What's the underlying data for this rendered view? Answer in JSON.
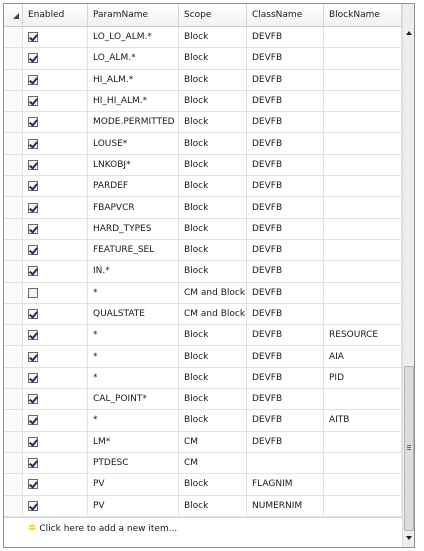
{
  "columns": {
    "enabled": "Enabled",
    "param_name": "ParamName",
    "scope": "Scope",
    "class_name": "ClassName",
    "block_name": "BlockName"
  },
  "rows": [
    {
      "enabled": true,
      "param": "LO_LO_ALM.*",
      "scope": "Block",
      "class": "DEVFB",
      "block": ""
    },
    {
      "enabled": true,
      "param": "LO_ALM.*",
      "scope": "Block",
      "class": "DEVFB",
      "block": ""
    },
    {
      "enabled": true,
      "param": "HI_ALM.*",
      "scope": "Block",
      "class": "DEVFB",
      "block": ""
    },
    {
      "enabled": true,
      "param": "HI_HI_ALM.*",
      "scope": "Block",
      "class": "DEVFB",
      "block": ""
    },
    {
      "enabled": true,
      "param": "MODE.PERMITTED",
      "scope": "Block",
      "class": "DEVFB",
      "block": ""
    },
    {
      "enabled": true,
      "param": "LOUSE*",
      "scope": "Block",
      "class": "DEVFB",
      "block": ""
    },
    {
      "enabled": true,
      "param": "LNKOBJ*",
      "scope": "Block",
      "class": "DEVFB",
      "block": ""
    },
    {
      "enabled": true,
      "param": "PARDEF",
      "scope": "Block",
      "class": "DEVFB",
      "block": ""
    },
    {
      "enabled": true,
      "param": "FBAPVCR",
      "scope": "Block",
      "class": "DEVFB",
      "block": ""
    },
    {
      "enabled": true,
      "param": "HARD_TYPES",
      "scope": "Block",
      "class": "DEVFB",
      "block": ""
    },
    {
      "enabled": true,
      "param": "FEATURE_SEL",
      "scope": "Block",
      "class": "DEVFB",
      "block": ""
    },
    {
      "enabled": true,
      "param": "IN.*",
      "scope": "Block",
      "class": "DEVFB",
      "block": ""
    },
    {
      "enabled": false,
      "param": "*",
      "scope": "CM and Block",
      "class": "DEVFB",
      "block": ""
    },
    {
      "enabled": true,
      "param": "QUALSTATE",
      "scope": "CM and Block",
      "class": "DEVFB",
      "block": ""
    },
    {
      "enabled": true,
      "param": "*",
      "scope": "Block",
      "class": "DEVFB",
      "block": "RESOURCE"
    },
    {
      "enabled": true,
      "param": "*",
      "scope": "Block",
      "class": "DEVFB",
      "block": "AIA"
    },
    {
      "enabled": true,
      "param": "*",
      "scope": "Block",
      "class": "DEVFB",
      "block": "PID"
    },
    {
      "enabled": true,
      "param": "CAL_POINT*",
      "scope": "Block",
      "class": "DEVFB",
      "block": ""
    },
    {
      "enabled": true,
      "param": "*",
      "scope": "Block",
      "class": "DEVFB",
      "block": "AITB"
    },
    {
      "enabled": true,
      "param": "LM*",
      "scope": "CM",
      "class": "DEVFB",
      "block": ""
    },
    {
      "enabled": true,
      "param": "PTDESC",
      "scope": "CM",
      "class": "",
      "block": ""
    },
    {
      "enabled": true,
      "param": "PV",
      "scope": "Block",
      "class": "FLAGNIM",
      "block": ""
    },
    {
      "enabled": true,
      "param": "PV",
      "scope": "Block",
      "class": "NUMERNIM",
      "block": ""
    }
  ],
  "add_row": {
    "label": "Click here to add a new item...",
    "icon": "new-item-star-icon"
  },
  "scrollbar": {
    "position_fraction": 1.0
  },
  "colors": {
    "grid_border": "#8f8f8f",
    "header_bg": "#f1f2f4",
    "checkmark": "#1c2f6a",
    "add_icon": "#e6b800"
  }
}
